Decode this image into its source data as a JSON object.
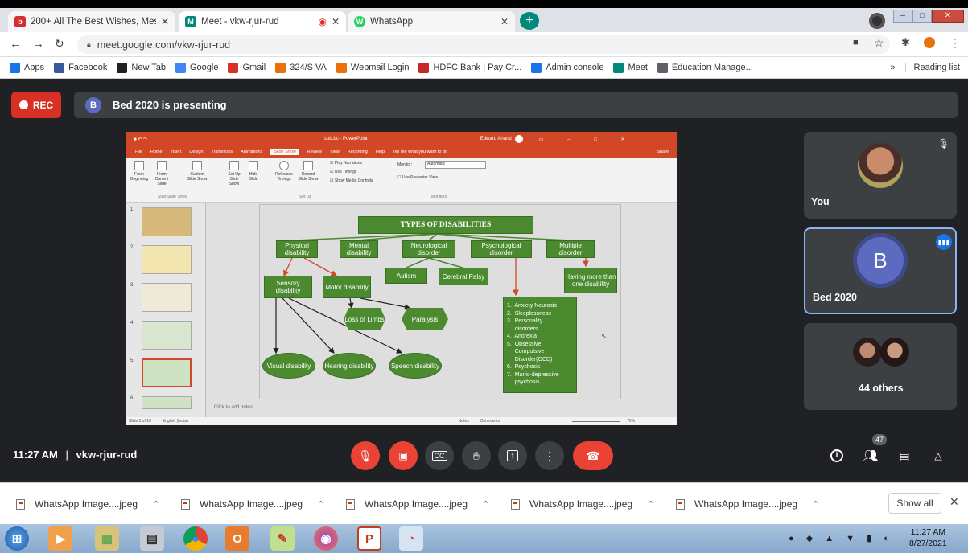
{
  "browser": {
    "tabs": [
      {
        "label": "200+ All The Best Wishes, Messa",
        "favicon_color": "#d32f2f",
        "favicon_text": "b"
      },
      {
        "label": "Meet - vkw-rjur-rud",
        "favicon_color": "#00897b",
        "favicon_text": "M"
      },
      {
        "label": "WhatsApp",
        "favicon_color": "#25d366",
        "favicon_text": "W"
      }
    ],
    "url": "meet.google.com/vkw-rjur-rud",
    "bookmarks": [
      {
        "label": "Apps",
        "color": "#1a73e8"
      },
      {
        "label": "Facebook",
        "color": "#3b5998"
      },
      {
        "label": "New Tab",
        "color": "#202124"
      },
      {
        "label": "Google",
        "color": "#4285f4"
      },
      {
        "label": "Gmail",
        "color": "#d93025"
      },
      {
        "label": "324/S VA",
        "color": "#e8710a"
      },
      {
        "label": "Webmail Login",
        "color": "#e8710a"
      },
      {
        "label": "HDFC Bank | Pay Cr...",
        "color": "#c62828"
      },
      {
        "label": "Admin console",
        "color": "#1a73e8"
      },
      {
        "label": "Meet",
        "color": "#00897b"
      },
      {
        "label": "Education Manage...",
        "color": "#5f6368"
      }
    ],
    "reading_list": "Reading list",
    "more_bookmarks": "»"
  },
  "meet": {
    "rec_label": "REC",
    "presenter_initial": "B",
    "presenting_text": "Bed 2020 is presenting",
    "time": "11:27 AM",
    "separator": "|",
    "meeting_code": "vkw-rjur-rud",
    "participant_count": "47",
    "tiles": [
      {
        "name": "You"
      },
      {
        "name": "Bed 2020",
        "initial": "B"
      },
      {
        "name": "44 others"
      }
    ]
  },
  "powerpoint": {
    "title": "sub.bc - PowerPoint",
    "user": "Edward Anand",
    "menu": [
      "File",
      "Home",
      "Insert",
      "Design",
      "Transitions",
      "Animations",
      "Slide Show",
      "Review",
      "View",
      "Recording",
      "Help",
      "Tell me what you want to do"
    ],
    "active_menu": "Slide Show",
    "share": "Share",
    "ribbon": {
      "from_beginning": "From Beginning",
      "from_current": "From Current Slide",
      "custom_show": "Custom Slide Show",
      "set_up": "Set Up Slide Show",
      "hide_slide": "Hide Slide",
      "rehearse": "Rehearse Timings",
      "record": "Record Slide Show",
      "play_narrations": "Play Narrations",
      "use_timings": "Use Timings",
      "show_media": "Show Media Controls",
      "monitor_label": "Monitor:",
      "monitor_value": "Automatic",
      "presenter_view": "Use Presenter View",
      "group_start": "Start Slide Show",
      "group_setup": "Set Up",
      "group_monitors": "Monitors"
    },
    "thumb_numbers": [
      "1",
      "2",
      "3",
      "4",
      "5",
      "6"
    ],
    "notes_placeholder": "Click to add notes",
    "status_left": "Slide 5 of 10",
    "status_lang": "English (India)",
    "status_notes": "Notes",
    "status_comments": "Comments",
    "zoom": "70%"
  },
  "slide": {
    "title": "TYPES OF DISABILITIES",
    "categories": [
      "Physical disability",
      "Mental disability",
      "Neurological disorder",
      "Psychological disorder",
      "Multiple disorder"
    ],
    "sensory": "Sensory disability",
    "motor": "Motor disability",
    "loss_of_limbs": "Loss of Limbs",
    "paralysis": "Paralysis",
    "visual": "Visual disability",
    "hearing": "Hearing disability",
    "speech": "Speech disability",
    "autism": "Autism",
    "cerebral": "Cerebral Palsy",
    "multiple_sub": "Having more than one disability",
    "psych_list": [
      "1.  Anxiety Neurosis",
      "2.  Sleeplessness",
      "3.  Personality",
      "     disorders",
      "4.  Anorexia",
      "5.  Obsessive",
      "     Compulsive",
      "     Disorder(OCD)",
      "6.  Psychosis",
      "7.  Manic-depressive",
      "     psychosis"
    ]
  },
  "downloads": {
    "items": [
      "WhatsApp Image....jpeg",
      "WhatsApp Image....jpeg",
      "WhatsApp Image....jpeg",
      "WhatsApp Image....jpeg",
      "WhatsApp Image....jpeg"
    ],
    "show_all": "Show all"
  },
  "taskbar": {
    "time": "11:27 AM",
    "date": "8/27/2021"
  },
  "colors": {
    "meet_bg": "#202124",
    "tile_bg": "#3c4043",
    "rec_red": "#d93025",
    "ppt_orange": "#d24726",
    "slide_green": "#4c8a2f",
    "active_speaker_border": "#8ab4f8"
  }
}
